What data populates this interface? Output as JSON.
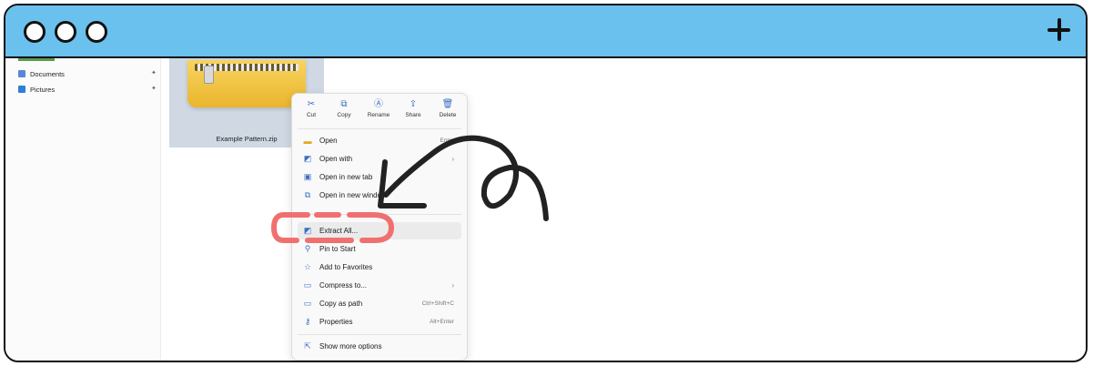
{
  "window": {
    "controls": [
      "window-dot",
      "window-dot",
      "window-dot"
    ],
    "new_tab_icon": "plus-icon"
  },
  "sidebar": {
    "items": [
      {
        "label": "Documents",
        "icon": "documents-icon",
        "color": "#5a86d6"
      },
      {
        "label": "Pictures",
        "icon": "pictures-icon",
        "color": "#2f7fd8"
      }
    ]
  },
  "file": {
    "name": "Example Pattern.zip"
  },
  "context_menu": {
    "quick_actions": [
      {
        "label": "Cut",
        "icon": "cut-icon",
        "glyph": "✂"
      },
      {
        "label": "Copy",
        "icon": "copy-icon",
        "glyph": "⧉"
      },
      {
        "label": "Rename",
        "icon": "rename-icon",
        "glyph": "Ⓐ"
      },
      {
        "label": "Share",
        "icon": "share-icon",
        "glyph": "⇪"
      },
      {
        "label": "Delete",
        "icon": "delete-icon",
        "glyph": "🗑"
      }
    ],
    "items": [
      {
        "label": "Open",
        "icon": "folder-icon",
        "glyph": "▬",
        "shortcut": "Enter"
      },
      {
        "label": "Open with",
        "icon": "open-with-icon",
        "glyph": "◩",
        "has_submenu": true
      },
      {
        "label": "Open in new tab",
        "icon": "new-tab-icon",
        "glyph": "▣"
      },
      {
        "label": "Open in new window",
        "icon": "new-window-icon",
        "glyph": "⧉"
      },
      {
        "label": "Extract All...",
        "icon": "extract-icon",
        "glyph": "◩",
        "highlighted": true
      },
      {
        "label": "Pin to Start",
        "icon": "pin-icon",
        "glyph": "⚲"
      },
      {
        "label": "Add to Favorites",
        "icon": "star-icon",
        "glyph": "☆"
      },
      {
        "label": "Compress to...",
        "icon": "compress-icon",
        "glyph": "▭",
        "has_submenu": true
      },
      {
        "label": "Copy as path",
        "icon": "copy-path-icon",
        "glyph": "▭",
        "shortcut": "Ctrl+Shift+C"
      },
      {
        "label": "Properties",
        "icon": "properties-icon",
        "glyph": "⚷",
        "shortcut": "Alt+Enter"
      },
      {
        "label": "Show more options",
        "icon": "more-options-icon",
        "glyph": "⇱"
      }
    ],
    "submenu_glyph": "›"
  },
  "annotation": {
    "arrow_icon": "curved-arrow-icon",
    "highlight_color": "#f07070",
    "arrow_color": "#222222"
  }
}
